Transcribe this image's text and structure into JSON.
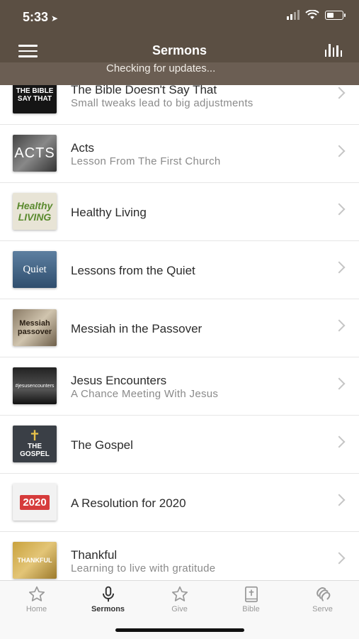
{
  "status": {
    "time": "5:33"
  },
  "header": {
    "title": "Sermons",
    "update_text": "Checking for updates..."
  },
  "sermons": [
    {
      "title": "The Bible Doesn't Say That",
      "subtitle": "Small tweaks lead to big adjustments",
      "thumb": "THE BIBLE SAY THAT"
    },
    {
      "title": "Acts",
      "subtitle": "Lesson From The First Church",
      "thumb": "ACTS"
    },
    {
      "title": "Healthy Living",
      "subtitle": "",
      "thumb": "Healthy LIVING"
    },
    {
      "title": "Lessons from the Quiet",
      "subtitle": "",
      "thumb": "Quiet"
    },
    {
      "title": "Messiah in the Passover",
      "subtitle": "",
      "thumb": "Messiah passover"
    },
    {
      "title": "Jesus Encounters",
      "subtitle": "A Chance Meeting With Jesus",
      "thumb": "#jesusencounters"
    },
    {
      "title": "The Gospel",
      "subtitle": "",
      "thumb": "THE GOSPEL"
    },
    {
      "title": "A Resolution for 2020",
      "subtitle": "",
      "thumb": "2020"
    },
    {
      "title": "Thankful",
      "subtitle": "Learning to live with gratitude",
      "thumb": "THANKFUL"
    }
  ],
  "tabs": [
    {
      "label": "Home",
      "icon": "star-icon"
    },
    {
      "label": "Sermons",
      "icon": "microphone-icon"
    },
    {
      "label": "Give",
      "icon": "star-icon"
    },
    {
      "label": "Bible",
      "icon": "bible-icon"
    },
    {
      "label": "Serve",
      "icon": "serve-icon"
    }
  ]
}
